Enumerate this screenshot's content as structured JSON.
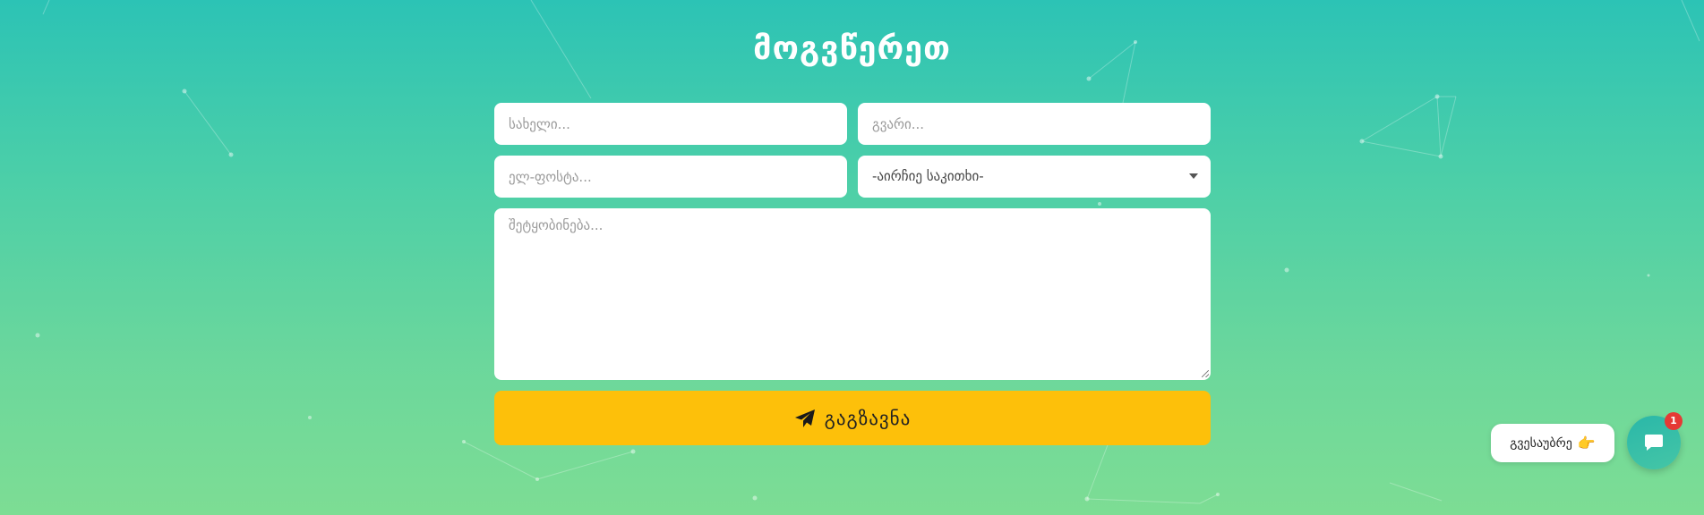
{
  "form": {
    "title": "მოგვწერეთ",
    "first_name_placeholder": "სახელი...",
    "last_name_placeholder": "გვარი...",
    "email_placeholder": "ელ-ფოსტა...",
    "subject_selected": "-აირჩიე საკითხი-",
    "message_placeholder": "შეტყობინება...",
    "send_label": "გაგზავნა"
  },
  "chat_widget": {
    "pill_label": "გვესაუბრე",
    "pill_emoji": "👉",
    "badge_count": "1",
    "fab_icon": "chat-bubble-icon"
  },
  "colors": {
    "send_button": "#fdc00a",
    "background_top": "#2cc3b5",
    "background_bottom": "#7ddd94",
    "badge": "#e53935"
  }
}
